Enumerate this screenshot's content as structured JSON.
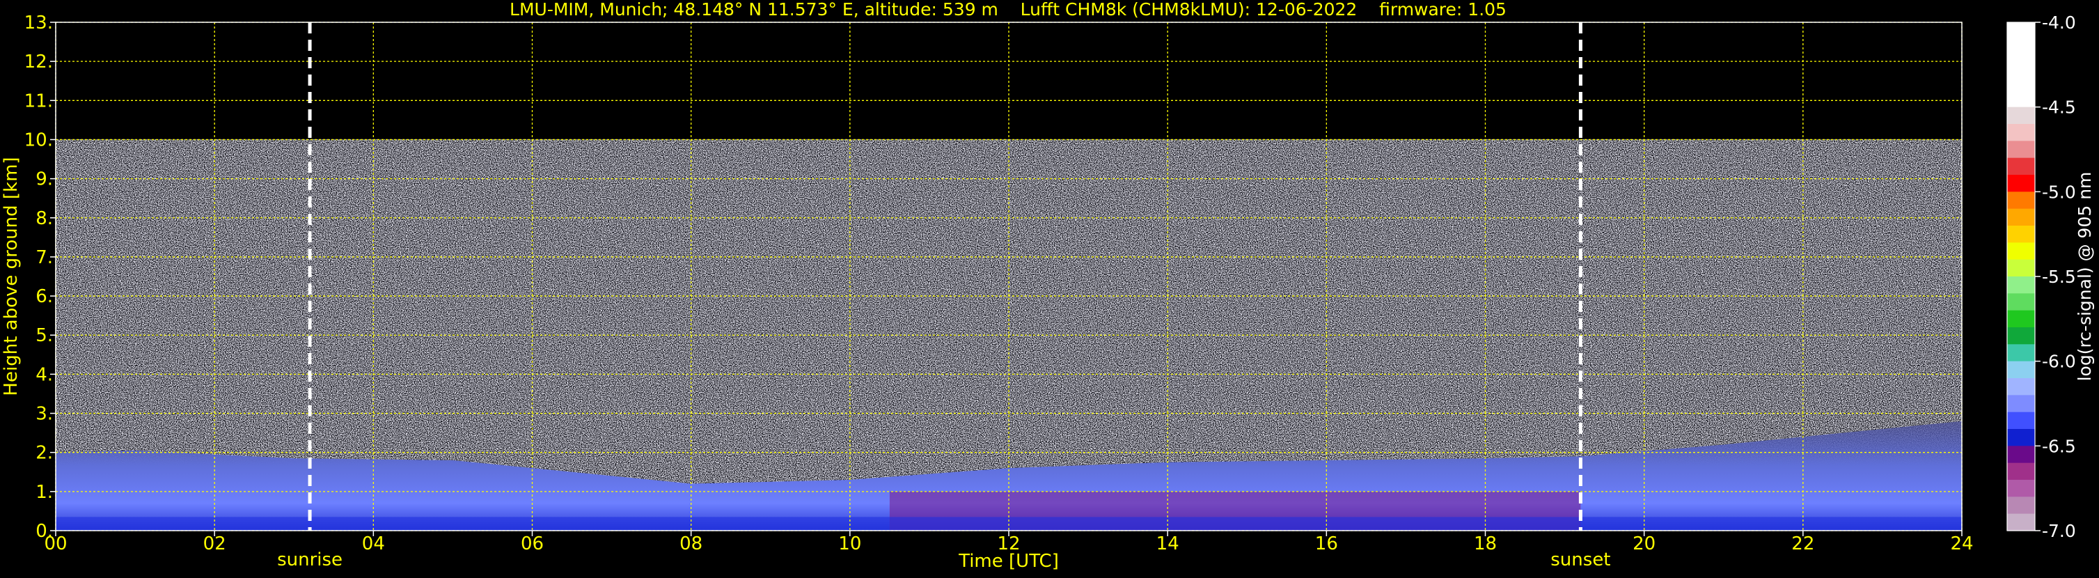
{
  "chart_data": {
    "type": "heatmap",
    "title": "LMU-MIM, Munich; 48.148° N 11.573° E, altitude: 539 m    Lufft CHM8k (CHM8kLMU): 12-06-2022    firmware: 1.05",
    "xlabel": "Time [UTC]",
    "ylabel": "Height above ground [km]",
    "xlim": [
      0,
      24
    ],
    "ylim": [
      0,
      13
    ],
    "x_ticks": [
      "00",
      "02",
      "04",
      "06",
      "08",
      "10",
      "12",
      "14",
      "16",
      "18",
      "20",
      "22",
      "24"
    ],
    "y_ticks": [
      "0.",
      "1.",
      "2.",
      "3.",
      "4.",
      "5.",
      "6.",
      "7.",
      "8.",
      "9.",
      "10.",
      "11.",
      "12.",
      "13."
    ],
    "grid": true,
    "data_top_km": 10,
    "markers": [
      {
        "label": "sunrise",
        "time": 3.2
      },
      {
        "label": "sunset",
        "time": 19.2
      }
    ],
    "boundary_layer": [
      {
        "time": 0,
        "top_km": 2.0
      },
      {
        "time": 1,
        "top_km": 2.05
      },
      {
        "time": 3,
        "top_km": 1.85
      },
      {
        "time": 5,
        "top_km": 1.8
      },
      {
        "time": 7,
        "top_km": 1.4
      },
      {
        "time": 8,
        "top_km": 1.2
      },
      {
        "time": 10,
        "top_km": 1.3
      },
      {
        "time": 12,
        "top_km": 1.6
      },
      {
        "time": 14,
        "top_km": 1.75
      },
      {
        "time": 16,
        "top_km": 1.8
      },
      {
        "time": 18,
        "top_km": 1.85
      },
      {
        "time": 19.2,
        "top_km": 1.9
      },
      {
        "time": 21,
        "top_km": 2.2
      },
      {
        "time": 23,
        "top_km": 2.6
      },
      {
        "time": 24,
        "top_km": 2.8
      }
    ],
    "colorbar": {
      "label": "log(rc-signal) @ 905 nm",
      "min": -7.0,
      "max": -4.0,
      "ticks": [
        "-4.0",
        "-4.5",
        "-5.0",
        "-5.5",
        "-6.0",
        "-6.5",
        "-7.0"
      ],
      "colors": [
        "#ffffff",
        "#ffffff",
        "#ffffff",
        "#ffffff",
        "#ffffff",
        "#e6d8da",
        "#f3c3c3",
        "#ea8e92",
        "#e8363a",
        "#ff0000",
        "#ff7a00",
        "#ffa800",
        "#ffd200",
        "#f0ff00",
        "#c9ff3a",
        "#90f08a",
        "#5fdc5f",
        "#1fc81f",
        "#10a83a",
        "#3cc8a8",
        "#8cd0f0",
        "#a0b4ff",
        "#7e8cff",
        "#4050ff",
        "#1020d0",
        "#6a0a8a",
        "#a0308a",
        "#b05aa8",
        "#b888b4",
        "#c8b0c8"
      ]
    }
  }
}
